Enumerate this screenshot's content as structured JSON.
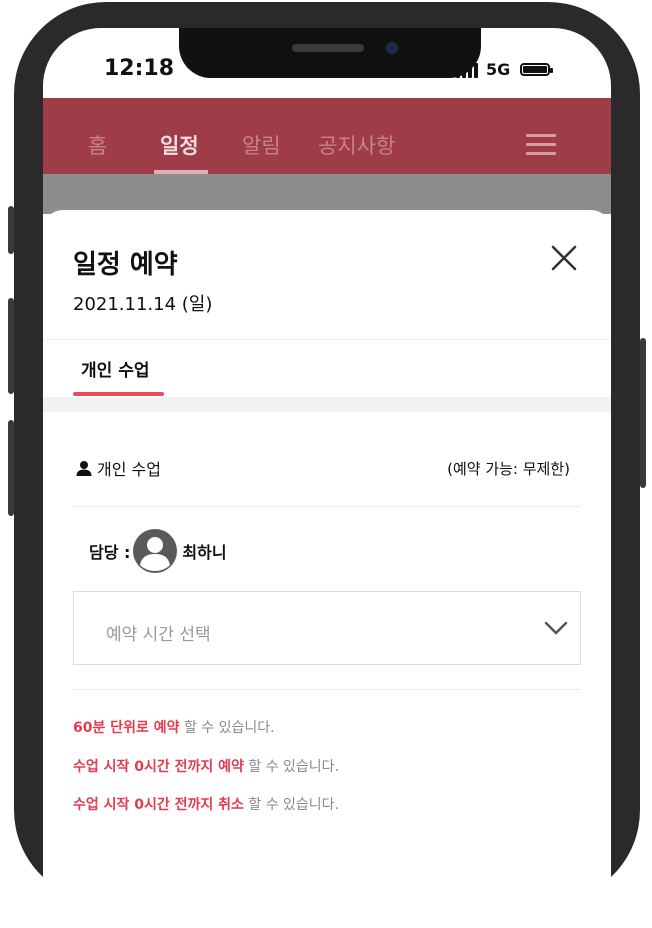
{
  "status_bar": {
    "time": "12:18",
    "network": "5G"
  },
  "nav": {
    "items": [
      "홈",
      "일정",
      "알림",
      "공지사항"
    ],
    "active_index": 1,
    "menu_icon": "hamburger-menu-icon"
  },
  "sheet": {
    "title": "일정 예약",
    "date": "2021.11.14 (일)",
    "close_icon": "close-icon",
    "tab_label": "개인 수업",
    "lesson": {
      "name": "개인 수업",
      "availability": "(예약 가능: 무제한)"
    },
    "instructor": {
      "label": "담당 :",
      "name": "최하니"
    },
    "time_select": {
      "placeholder": "예약 시간 선택"
    },
    "notes": [
      {
        "highlight": "60분 단위로 예약",
        "rest": " 할 수 있습니다."
      },
      {
        "highlight": "수업 시작 0시간 전까지 예약",
        "rest": " 할 수 있습니다."
      },
      {
        "highlight": "수업 시작 0시간 전까지 취소",
        "rest": " 할 수 있습니다."
      }
    ]
  },
  "colors": {
    "accent": "#ea4a5c",
    "nav_background": "#9e3c48",
    "highlight_text": "#e33b4f"
  }
}
